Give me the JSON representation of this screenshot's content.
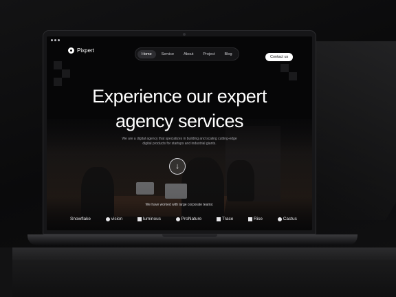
{
  "site": {
    "brand": "Pixpert",
    "nav": [
      {
        "label": "Home",
        "active": true
      },
      {
        "label": "Service",
        "active": false
      },
      {
        "label": "About",
        "active": false
      },
      {
        "label": "Project",
        "active": false
      },
      {
        "label": "Blog",
        "active": false
      }
    ],
    "contact_label": "Contact us"
  },
  "hero": {
    "title_line1": "Experience our expert",
    "title_line2": "agency services",
    "subtitle": "We are a digital agency that specializes in building and scaling cutting-edge digital products for startups and industrial giants.",
    "scroll_icon": "arrow-down-icon"
  },
  "clients": {
    "heading": "We have worked with large corporate teams:",
    "logos": [
      "Snowflake",
      "vision",
      "luminous",
      "ProNature",
      "Trace",
      "Rise",
      "Cactus"
    ]
  }
}
